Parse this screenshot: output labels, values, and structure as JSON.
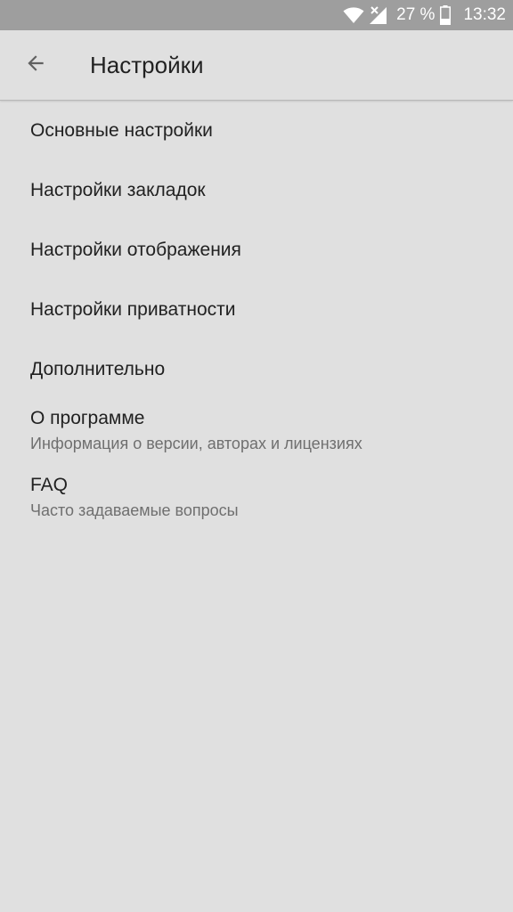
{
  "status_bar": {
    "battery": "27 %",
    "time": "13:32",
    "icons": [
      "wifi-icon",
      "no-signal-icon",
      "battery-icon"
    ]
  },
  "app_bar": {
    "back_icon": "arrow-back-icon",
    "title": "Настройки"
  },
  "settings": {
    "items": [
      {
        "label": "Основные настройки"
      },
      {
        "label": "Настройки закладок"
      },
      {
        "label": "Настройки отображения"
      },
      {
        "label": "Настройки приватности"
      },
      {
        "label": "Дополнительно"
      },
      {
        "label": "О программе",
        "summary": "Информация о версии, авторах и лицензиях"
      },
      {
        "label": "FAQ",
        "summary": "Часто задаваемые вопросы"
      }
    ]
  },
  "colors": {
    "background": "#e0e0e0",
    "status_bar": "#9e9e9e",
    "text_primary": "#212121",
    "text_secondary": "#6f6f6f"
  }
}
